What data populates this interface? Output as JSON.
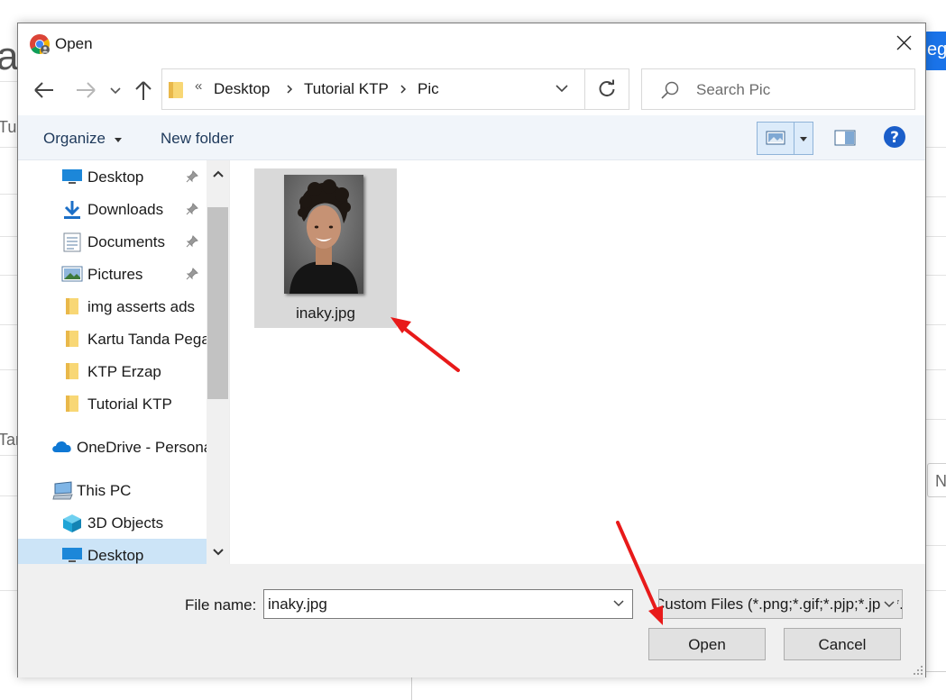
{
  "background": {
    "partial_letter": "a",
    "blue_button_partial": "eg",
    "frag_left_1": "Tu",
    "frag_left_2": "Tar",
    "frag_right": "N"
  },
  "dialog": {
    "title": "Open",
    "address": {
      "overflow": "«",
      "crumbs": [
        "Desktop",
        "Tutorial KTP",
        "Pic"
      ]
    },
    "search": {
      "placeholder": "Search Pic"
    },
    "toolbar": {
      "organize": "Organize",
      "new_folder": "New folder"
    },
    "nav_items": [
      {
        "label": "Desktop",
        "icon": "desktop-icon",
        "pinned": true
      },
      {
        "label": "Downloads",
        "icon": "download-icon",
        "pinned": true
      },
      {
        "label": "Documents",
        "icon": "documents-icon",
        "pinned": true
      },
      {
        "label": "Pictures",
        "icon": "pictures-icon",
        "pinned": true
      },
      {
        "label": "img asserts ads",
        "icon": "folder-icon"
      },
      {
        "label": "Kartu Tanda Pegawai",
        "icon": "folder-icon"
      },
      {
        "label": "KTP Erzap",
        "icon": "folder-icon"
      },
      {
        "label": "Tutorial KTP",
        "icon": "folder-icon"
      },
      {
        "label": "OneDrive - Personal",
        "icon": "onedrive-icon"
      },
      {
        "label": "This PC",
        "icon": "this-pc-icon"
      },
      {
        "label": "3D Objects",
        "icon": "3d-objects-icon"
      },
      {
        "label": "Desktop",
        "icon": "desktop-icon",
        "selected": true
      }
    ],
    "files": [
      {
        "name": "inaky.jpg"
      }
    ],
    "file_name_label": "File name:",
    "file_name_value": "inaky.jpg",
    "file_type_value": "Custom Files (*.png;*.gif;*.pjp;*.jpg;*.jpeg)",
    "open_button": "Open",
    "cancel_button": "Cancel"
  },
  "colors": {
    "toolbar_bg": "#f1f5fa",
    "selection": "#cce4f7",
    "annotation_arrow": "#e81a1a",
    "chrome_blue": "#1a73e8"
  }
}
